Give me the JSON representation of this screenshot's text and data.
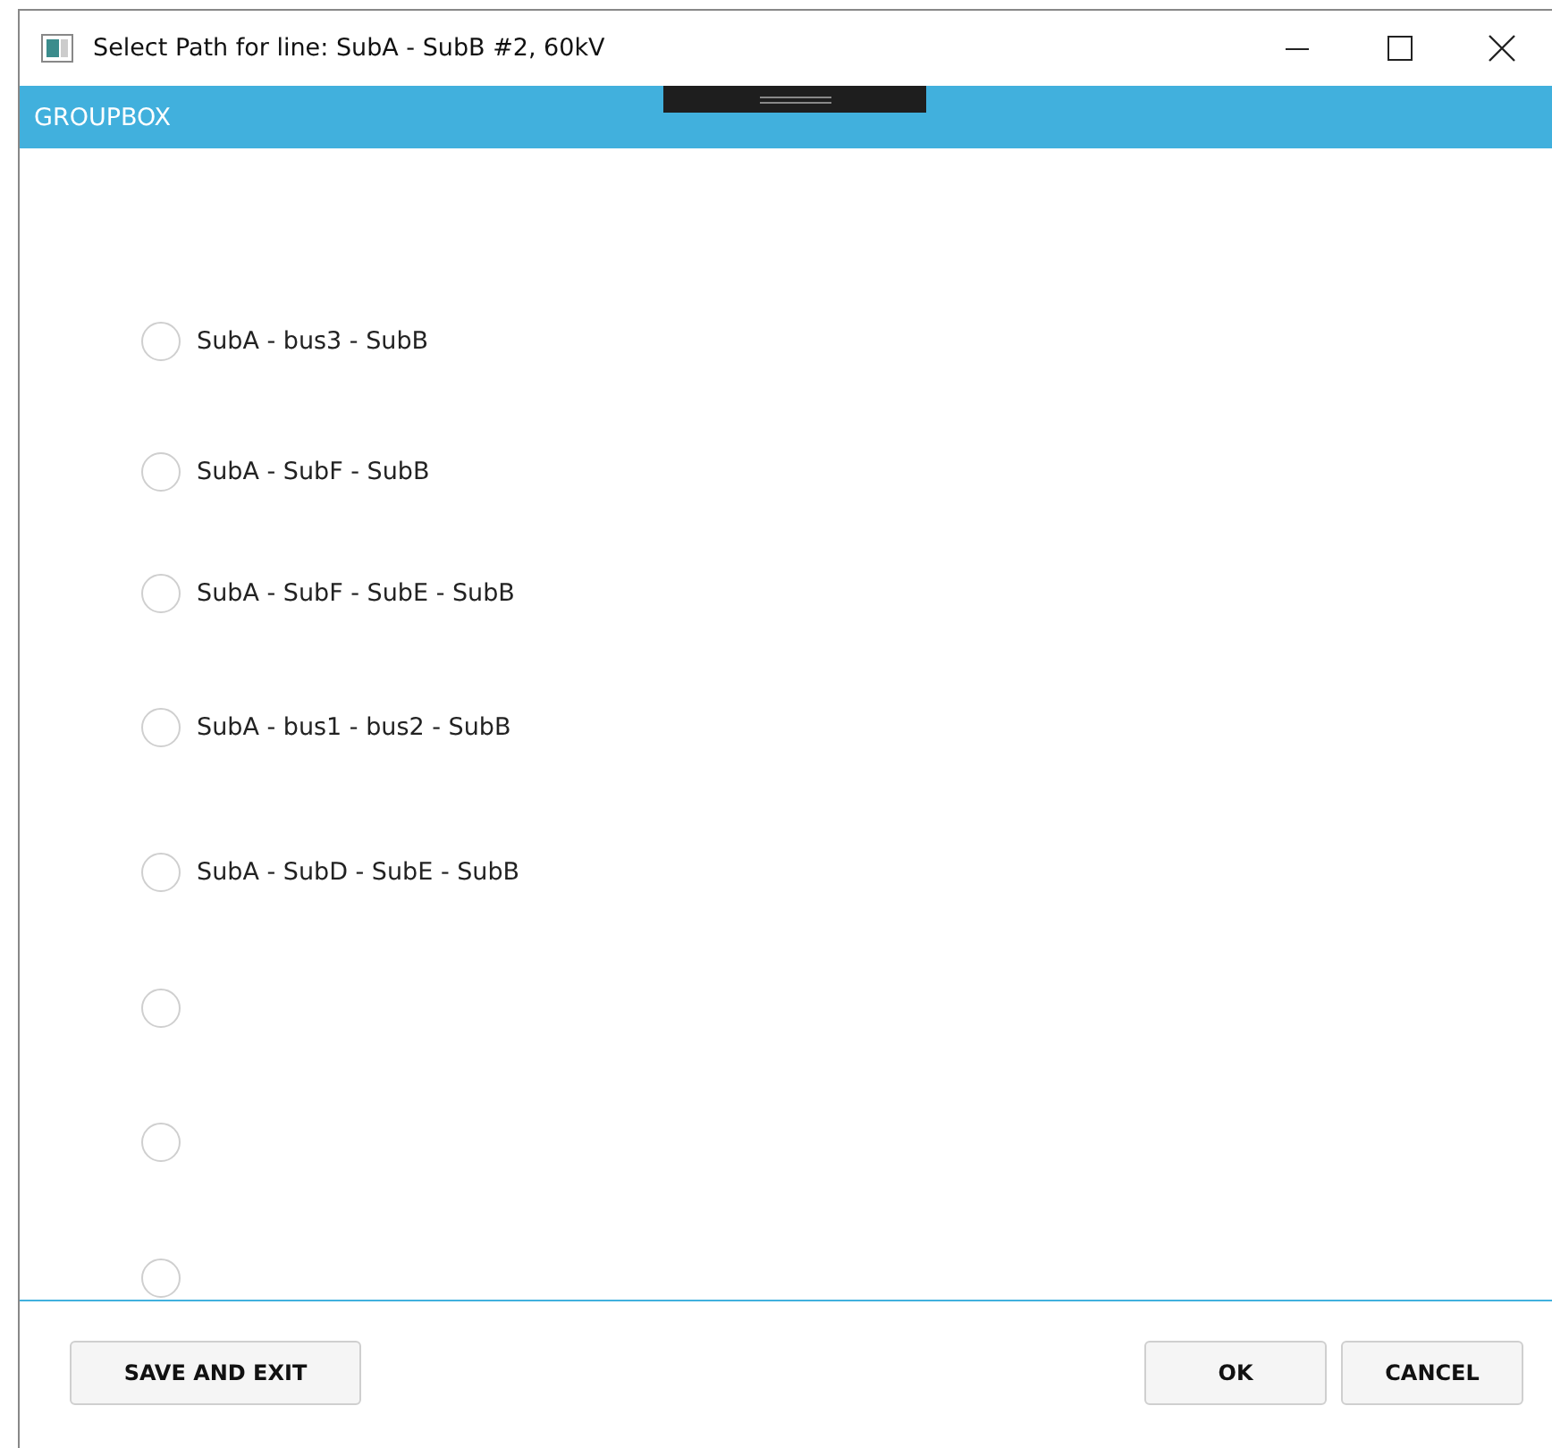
{
  "window": {
    "title": "Select Path for line: SubA - SubB #2, 60kV"
  },
  "groupbox": {
    "header": "GROUPBOX"
  },
  "paths": [
    {
      "label": "SubA - bus3 - SubB",
      "selected": false
    },
    {
      "label": "SubA - SubF - SubB",
      "selected": false
    },
    {
      "label": "SubA - SubF - SubE - SubB",
      "selected": false
    },
    {
      "label": "SubA - bus1 - bus2 - SubB",
      "selected": false
    },
    {
      "label": "SubA - SubD - SubE - SubB",
      "selected": false
    },
    {
      "selected": false
    },
    {
      "selected": false
    },
    {
      "selected": false
    }
  ],
  "buttons_left": [
    "SAVE AND EXIT"
  ],
  "buttons_right": [
    "OK",
    "CANCEL"
  ]
}
